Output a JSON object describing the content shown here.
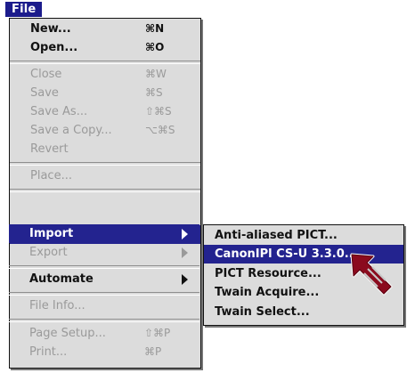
{
  "menubar": {
    "title": "File"
  },
  "file_menu": {
    "items": [
      {
        "label": "New...",
        "shortcut": "⌘N",
        "enabled": true
      },
      {
        "label": "Open...",
        "shortcut": "⌘O",
        "enabled": true
      },
      {
        "label": "Close",
        "shortcut": "⌘W",
        "enabled": false
      },
      {
        "label": "Save",
        "shortcut": "⌘S",
        "enabled": false
      },
      {
        "label": "Save As...",
        "shortcut": "⇧⌘S",
        "enabled": false
      },
      {
        "label": "Save a Copy...",
        "shortcut": "⌥⌘S",
        "enabled": false
      },
      {
        "label": "Revert",
        "shortcut": "",
        "enabled": false
      },
      {
        "label": "Place...",
        "shortcut": "",
        "enabled": false
      },
      {
        "label": "Import",
        "shortcut": "",
        "enabled": true,
        "submenu": true,
        "highlighted": true
      },
      {
        "label": "Export",
        "shortcut": "",
        "enabled": false,
        "submenu": true
      },
      {
        "label": "Automate",
        "shortcut": "",
        "enabled": true,
        "submenu": true
      },
      {
        "label": "File Info...",
        "shortcut": "",
        "enabled": false
      },
      {
        "label": "Page Setup...",
        "shortcut": "⇧⌘P",
        "enabled": false
      },
      {
        "label": "Print...",
        "shortcut": "⌘P",
        "enabled": false
      }
    ]
  },
  "import_submenu": {
    "items": [
      {
        "label": "Anti-aliased PICT...",
        "highlighted": false
      },
      {
        "label": "CanonIPl CS-U 3.3.0...",
        "highlighted": true
      },
      {
        "label": "PICT Resource...",
        "highlighted": false
      },
      {
        "label": "Twain Acquire...",
        "highlighted": false
      },
      {
        "label": "Twain Select...",
        "highlighted": false
      }
    ]
  },
  "colors": {
    "highlight": "#23238f",
    "menu_background": "#dcdcdc",
    "pointer_arrow": "#8b0a1e"
  },
  "icons": {
    "pointer": "arrow-pointer-icon"
  }
}
